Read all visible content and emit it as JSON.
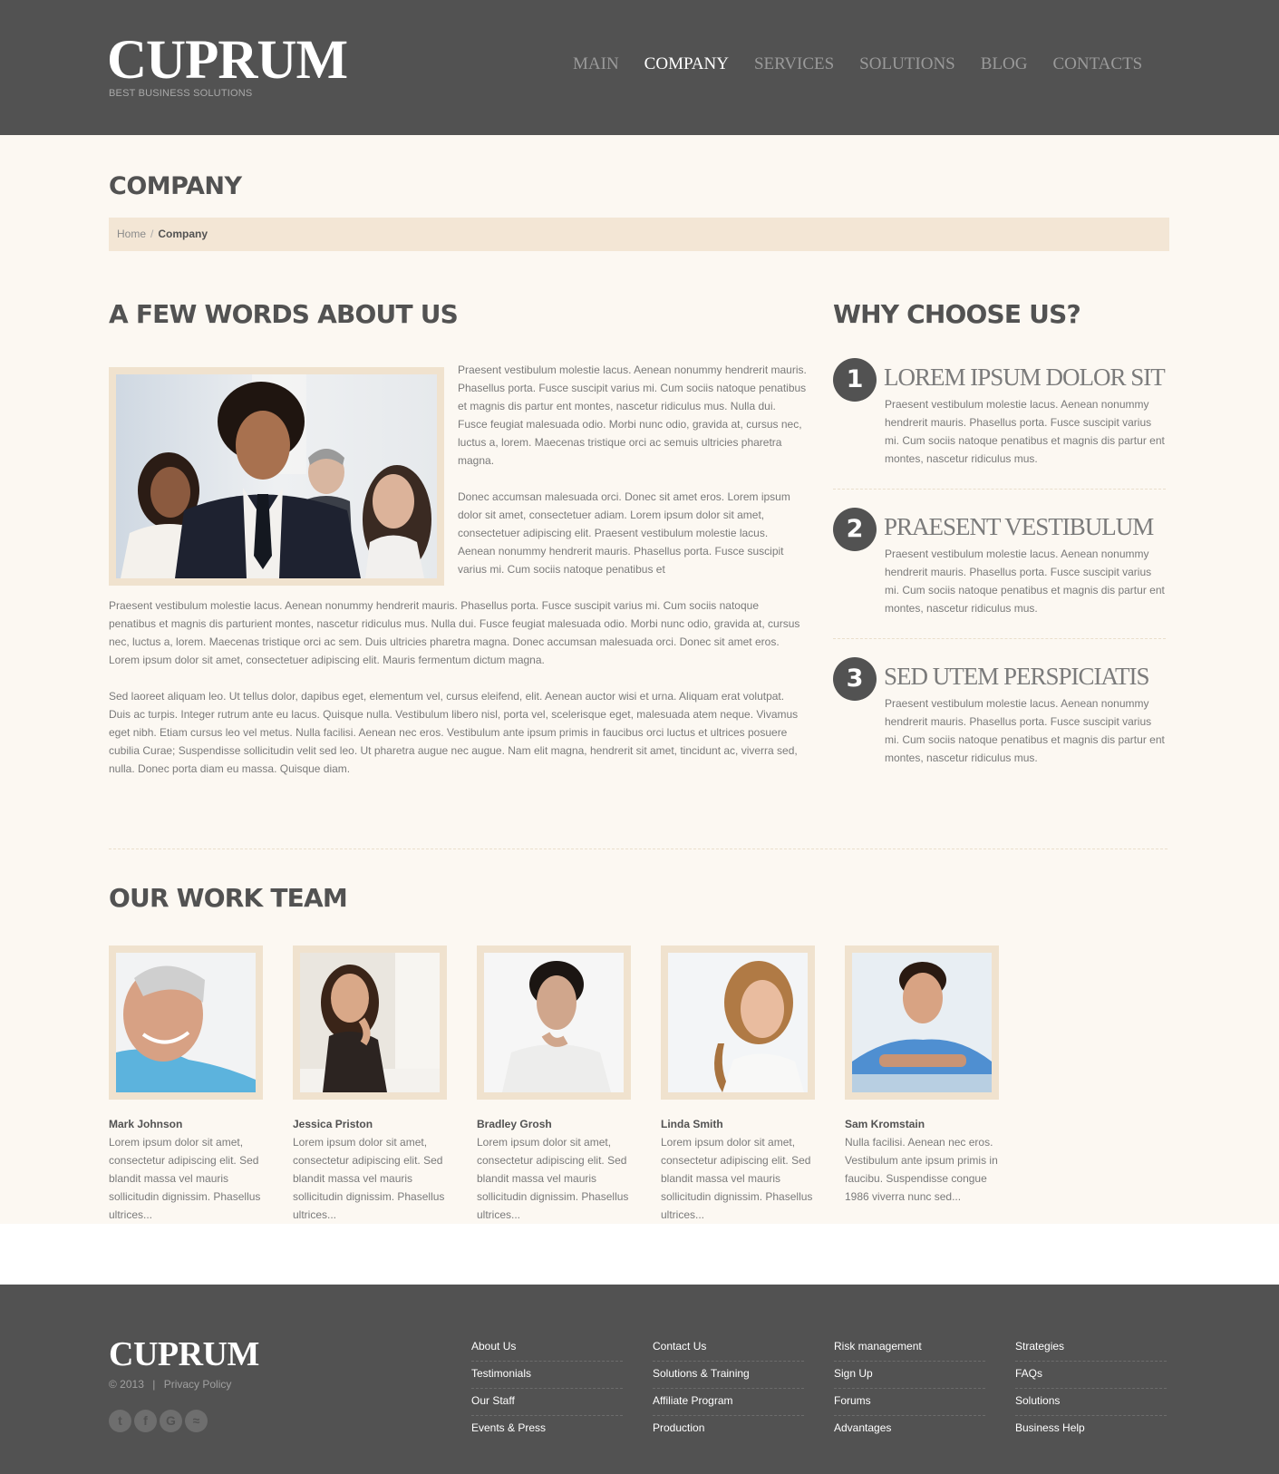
{
  "header": {
    "logo": "CUPRUM",
    "tagline": "BEST BUSINESS SOLUTIONS",
    "nav": [
      {
        "label": "MAIN"
      },
      {
        "label": "COMPANY"
      },
      {
        "label": "SERVICES"
      },
      {
        "label": "SOLUTIONS"
      },
      {
        "label": "BLOG"
      },
      {
        "label": "CONTACTS"
      }
    ]
  },
  "page": {
    "title": "COMPANY",
    "breadcrumb": {
      "home": "Home",
      "separator": "/",
      "current": "Company"
    }
  },
  "about": {
    "title": "A FEW WORDS ABOUT US",
    "p1": "Praesent vestibulum molestie lacus. Aenean nonummy hendrerit mauris. Phasellus porta. Fusce suscipit varius mi. Cum sociis natoque penatibus et magnis dis partur ent montes, nascetur ridiculus mus. Nulla dui. Fusce feugiat malesuada odio. Morbi nunc odio, gravida at, cursus nec, luctus a, lorem. Maecenas tristique orci ac semuis ultricies pharetra magna.",
    "p2": "Donec accumsan malesuada orci. Donec sit amet eros. Lorem ipsum dolor sit amet, consectetuer adiam. Lorem ipsum dolor sit amet, consectetuer adipiscing elit. Praesent vestibulum molestie lacus. Aenean nonummy hendrerit mauris. Phasellus porta. Fusce suscipit varius mi. Cum sociis natoque penatibus et",
    "p3": "Praesent vestibulum molestie lacus. Aenean nonummy hendrerit mauris. Phasellus porta. Fusce suscipit varius mi. Cum sociis natoque penatibus et magnis dis parturient montes, nascetur ridiculus mus. Nulla dui. Fusce feugiat malesuada odio. Morbi nunc odio, gravida at, cursus nec, luctus a, lorem. Maecenas tristique orci ac sem. Duis ultricies pharetra magna. Donec accumsan malesuada orci. Donec sit amet eros. Lorem ipsum dolor sit amet, consectetuer adipiscing elit. Mauris fermentum dictum magna.",
    "p4": "Sed laoreet aliquam leo. Ut tellus dolor, dapibus eget, elementum vel, cursus eleifend, elit. Aenean auctor wisi et urna. Aliquam erat volutpat. Duis ac turpis. Integer rutrum ante eu lacus. Quisque nulla. Vestibulum libero nisl, porta vel, scelerisque eget, malesuada atem neque. Vivamus eget nibh. Etiam cursus leo vel metus. Nulla facilisi. Aenean nec eros. Vestibulum ante ipsum primis in faucibus orci luctus et ultrices posuere cubilia Curae; Suspendisse sollicitudin velit sed leo. Ut pharetra augue nec augue. Nam elit magna, hendrerit sit amet, tincidunt ac, viverra sed, nulla. Donec porta diam eu massa. Quisque diam."
  },
  "why": {
    "title": "WHY CHOOSE US?",
    "items": [
      {
        "num": "1",
        "heading": "LOREM IPSUM DOLOR SIT",
        "text": "Praesent vestibulum molestie lacus. Aenean nonummy hendrerit mauris. Phasellus porta. Fusce suscipit varius mi. Cum sociis natoque penatibus et magnis dis partur ent montes, nascetur ridiculus mus."
      },
      {
        "num": "2",
        "heading": "PRAESENT VESTIBULUM",
        "text": "Praesent vestibulum molestie lacus. Aenean nonummy hendrerit mauris. Phasellus porta. Fusce suscipit varius mi. Cum sociis natoque penatibus et magnis dis partur ent montes, nascetur ridiculus mus."
      },
      {
        "num": "3",
        "heading": "SED UTEM PERSPICIATIS",
        "text": "Praesent vestibulum molestie lacus. Aenean nonummy hendrerit mauris. Phasellus porta. Fusce suscipit varius mi. Cum sociis natoque penatibus et magnis dis partur ent montes, nascetur ridiculus mus."
      }
    ]
  },
  "team": {
    "title": "OUR WORK TEAM",
    "members": [
      {
        "name": "Mark Johnson",
        "text": "Lorem ipsum dolor sit amet, consectetur adipiscing elit. Sed blandit massa vel mauris sollicitudin dignissim. Phasellus ultrices..."
      },
      {
        "name": "Jessica Priston",
        "text": "Lorem ipsum dolor sit amet, consectetur adipiscing elit. Sed blandit massa vel mauris sollicitudin dignissim. Phasellus ultrices..."
      },
      {
        "name": "Bradley Grosh",
        "text": "Lorem ipsum dolor sit amet, consectetur adipiscing elit. Sed blandit massa vel mauris sollicitudin dignissim. Phasellus ultrices..."
      },
      {
        "name": "Linda Smith",
        "text": "Lorem ipsum dolor sit amet, consectetur adipiscing elit. Sed blandit massa vel mauris sollicitudin dignissim. Phasellus ultrices..."
      },
      {
        "name": "Sam Kromstain",
        "text": "Nulla facilisi. Aenean nec eros. Vestibulum ante ipsum primis in faucibu. Suspendisse congue 1986 viverra nunc sed..."
      }
    ]
  },
  "footer": {
    "logo": "CUPRUM",
    "copyright": "© 2013",
    "separator": "|",
    "privacy": "Privacy Policy",
    "social": [
      "twitter-icon",
      "facebook-icon",
      "google-icon",
      "rss-icon"
    ],
    "columns": [
      [
        "About Us",
        "Testimonials",
        "Our Staff",
        "Events & Press"
      ],
      [
        "Contact Us",
        "Solutions & Training",
        "Affiliate Program",
        "Production"
      ],
      [
        "Risk management",
        "Sign Up",
        "Forums",
        "Advantages"
      ],
      [
        "Strategies",
        "FAQs",
        "Solutions",
        "Business Help"
      ]
    ]
  },
  "colors": {
    "header_bg": "#525252",
    "content_bg": "#fcf8f2",
    "breadcrumb_bg": "#f3e6d5",
    "photo_frame": "#f0e2ce",
    "heading": "#525252",
    "body_text": "#7a7a7a"
  }
}
